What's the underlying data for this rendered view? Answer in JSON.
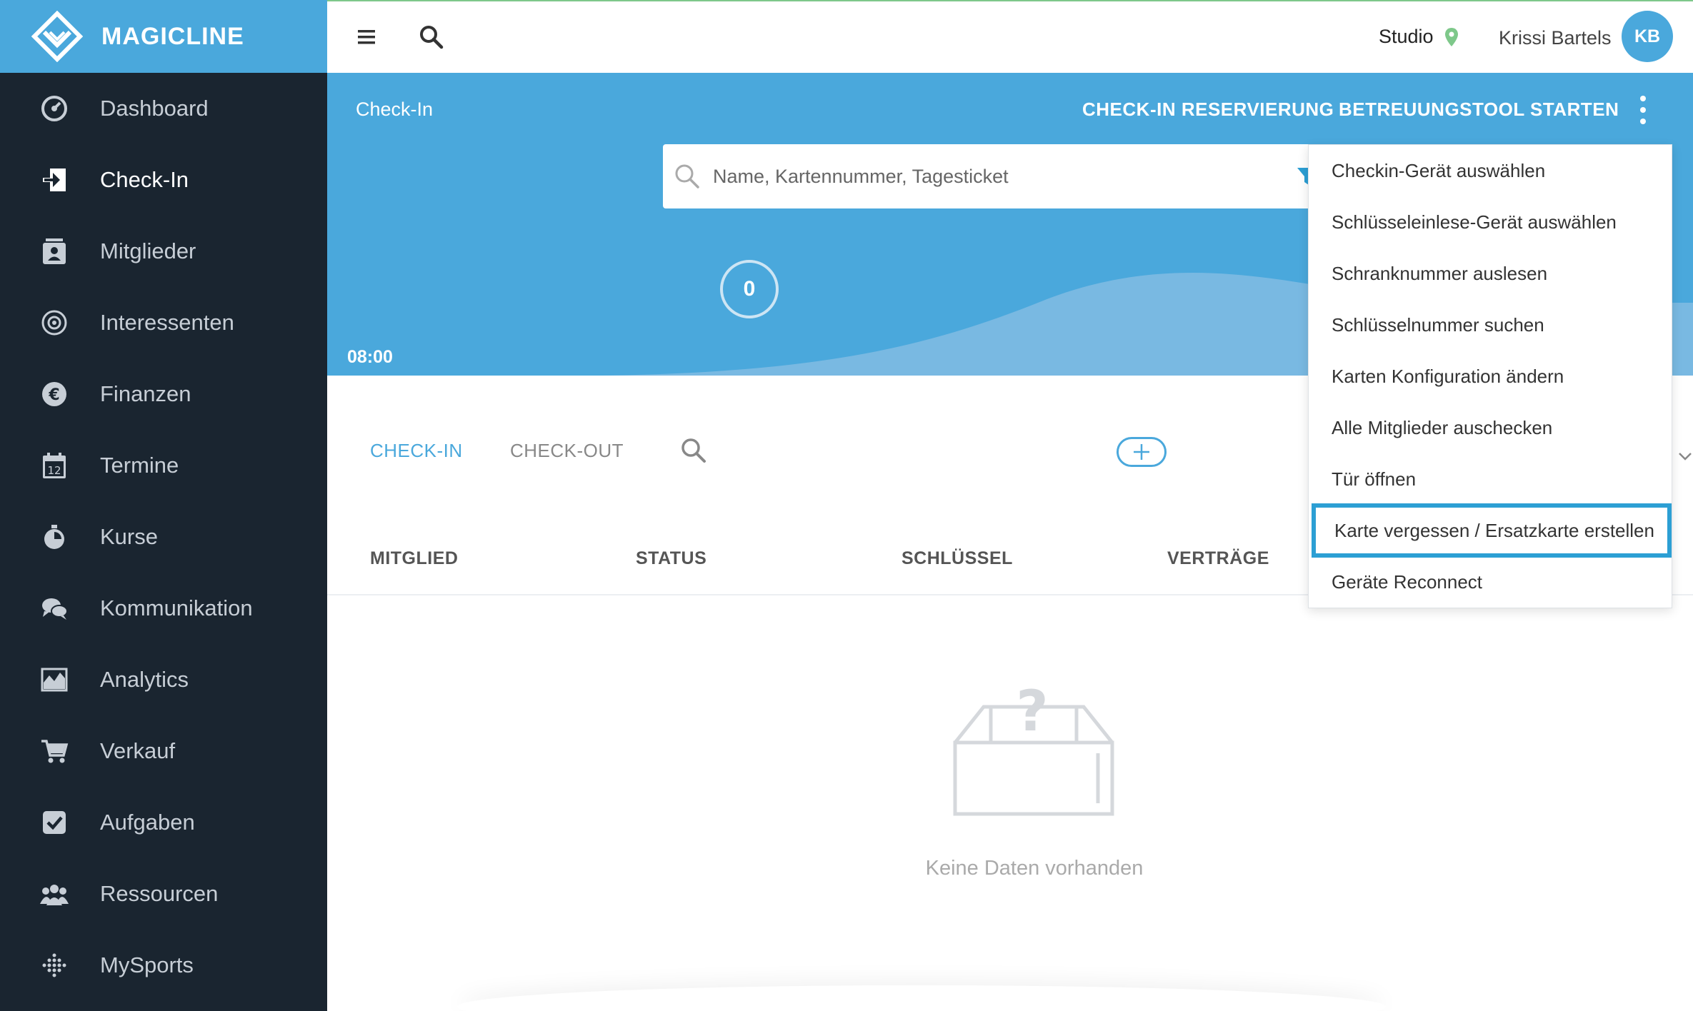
{
  "app": {
    "logo_text": "MAGICLINE"
  },
  "sidebar": {
    "items": [
      {
        "label": "Dashboard",
        "icon": "dashboard-icon"
      },
      {
        "label": "Check-In",
        "icon": "checkin-arrow-icon",
        "active": true
      },
      {
        "label": "Mitglieder",
        "icon": "member-card-icon"
      },
      {
        "label": "Interessenten",
        "icon": "target-icon"
      },
      {
        "label": "Finanzen",
        "icon": "euro-icon"
      },
      {
        "label": "Termine",
        "icon": "calendar-icon"
      },
      {
        "label": "Kurse",
        "icon": "stopwatch-icon"
      },
      {
        "label": "Kommunikation",
        "icon": "chat-icon"
      },
      {
        "label": "Analytics",
        "icon": "chart-area-icon"
      },
      {
        "label": "Verkauf",
        "icon": "cart-icon"
      },
      {
        "label": "Aufgaben",
        "icon": "checkbox-icon"
      },
      {
        "label": "Ressourcen",
        "icon": "group-icon"
      },
      {
        "label": "MySports",
        "icon": "dots-grid-icon"
      }
    ]
  },
  "header": {
    "studio_label": "Studio",
    "user_name": "Krissi Bartels",
    "avatar_initials": "KB"
  },
  "band": {
    "page_title": "Check-In",
    "action_reservation": "CHECK-IN RESERVIERUNG",
    "action_tool": "BETREUUNGSTOOL STARTEN",
    "search_placeholder": "Name, Kartennummer, Tagesticket",
    "time_label": "08:00",
    "checkin_count": "0"
  },
  "tabs": {
    "checkin": "CHECK-IN",
    "checkout": "CHECK-OUT"
  },
  "table": {
    "columns": [
      "MITGLIED",
      "STATUS",
      "SCHLÜSSEL",
      "VERTRÄGE"
    ],
    "empty_text": "Keine Daten vorhanden"
  },
  "menu": {
    "items": [
      "Checkin-Gerät auswählen",
      "Schlüsseleinlese-Gerät auswählen",
      "Schranknummer auslesen",
      "Schlüsselnummer suchen",
      "Karten Konfiguration ändern",
      "Alle Mitglieder auschecken",
      "Tür öffnen",
      "Karte vergessen / Ersatzkarte erstellen",
      "Geräte Reconnect"
    ],
    "highlighted_index": 7
  },
  "colors": {
    "brand_blue": "#4aa8dc",
    "sidebar_bg": "#1a2530",
    "location_green": "#7ec88a"
  }
}
